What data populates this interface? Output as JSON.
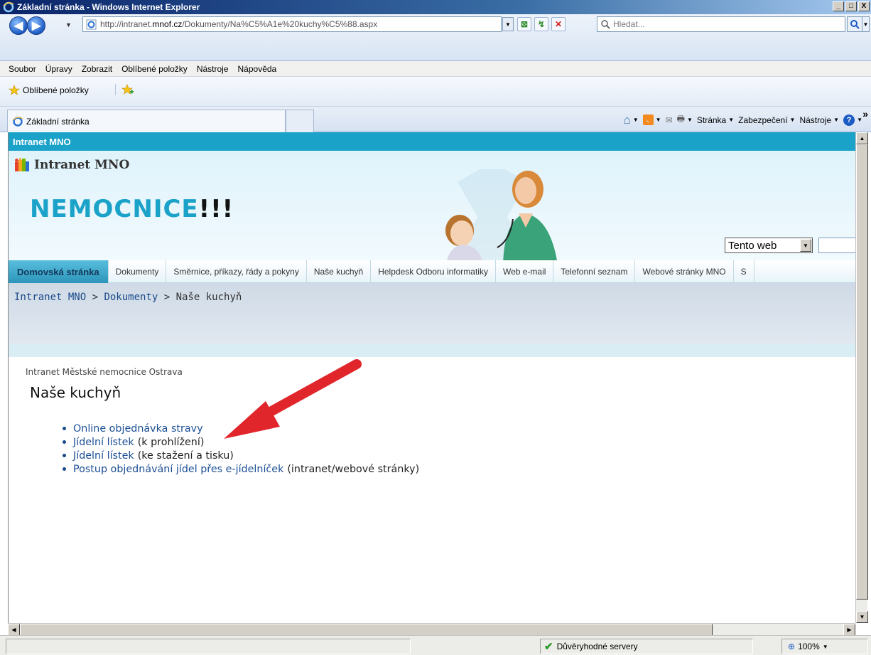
{
  "window": {
    "title": "Základní stránka - Windows Internet Explorer",
    "minimize": "_",
    "maximize": "□",
    "close": "X"
  },
  "address": {
    "url_prefix": "http://intranet.",
    "url_domain": "mnof.cz",
    "url_path": "/Dokumenty/Na%C5%A1e%20kuchy%C5%88.aspx",
    "search_placeholder": "Hledat..."
  },
  "menu": [
    "Soubor",
    "Úpravy",
    "Zobrazit",
    "Oblíbené položky",
    "Nástroje",
    "Nápověda"
  ],
  "favorites": {
    "label": "Oblíbené položky"
  },
  "tab": {
    "title": "Základní stránka"
  },
  "command_bar": {
    "page": "Stránka",
    "safety": "Zabezpečení",
    "tools": "Nástroje",
    "more": "»"
  },
  "site": {
    "top_bar_title": "Intranet MNO",
    "title": "Intranet MNO",
    "brand_text": "NEMOCNICE",
    "brand_exclaim": "!!!",
    "search_scope": "Tento web",
    "brand_color": "#1ba2c9"
  },
  "topnav": [
    "Domovská stránka",
    "Dokumenty",
    "Směrnice, příkazy, řády a pokyny",
    "Naše kuchyň",
    "Helpdesk Odboru informatiky",
    "Web e-mail",
    "Telefonní seznam",
    "Webové stránky MNO",
    "S"
  ],
  "breadcrumb": {
    "root": "Intranet MNO",
    "sep": " > ",
    "parent": "Dokumenty",
    "current": "Naše kuchyň"
  },
  "content": {
    "subtitle": "Intranet Městské nemocnice Ostrava",
    "heading": "Naše kuchyň",
    "links": [
      {
        "text": "Online objednávka stravy",
        "note": ""
      },
      {
        "text": "Jídelní lístek",
        "note": "(k prohlížení)"
      },
      {
        "text": "Jídelní lístek",
        "note": "(ke stažení a tisku)"
      },
      {
        "text": "Postup objednávání jídel přes e-jídelníček",
        "note": "(intranet/webové stránky)"
      }
    ]
  },
  "status": {
    "zone": "Důvěryhodné servery",
    "zoom": "100%"
  }
}
